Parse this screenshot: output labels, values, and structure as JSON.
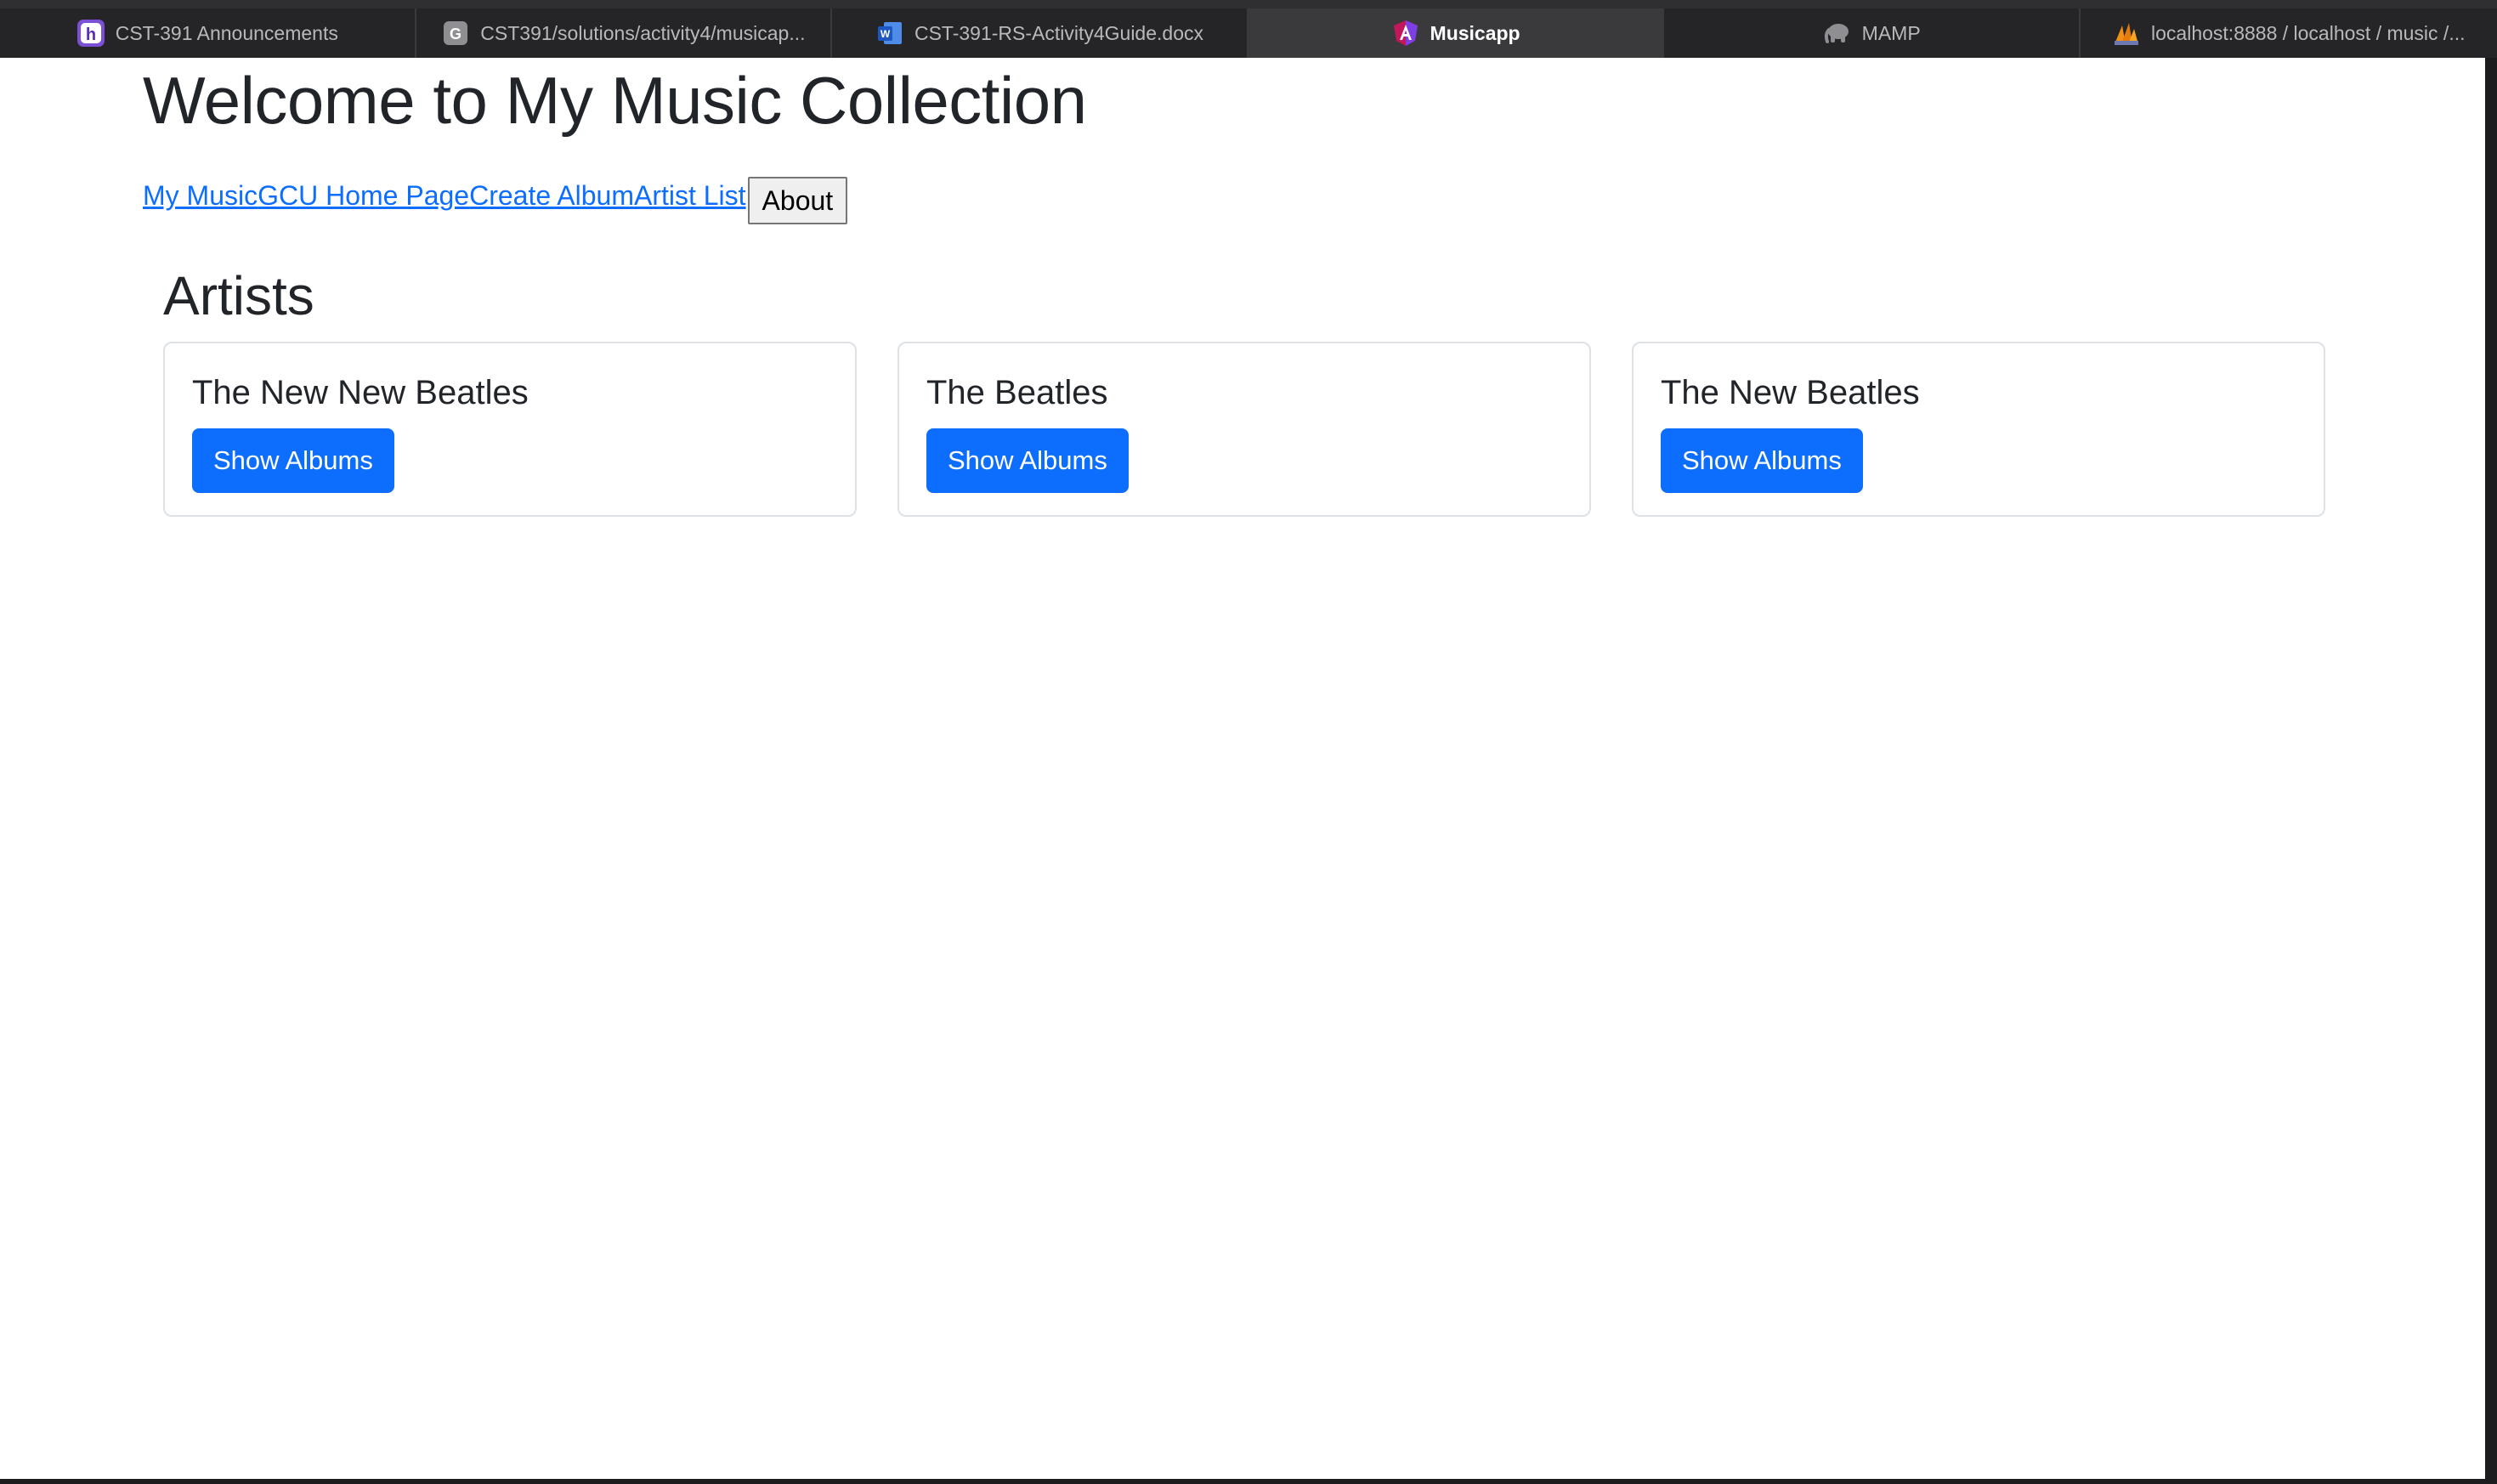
{
  "browser": {
    "tabs": [
      {
        "label": "CST-391 Announcements",
        "icon": "h-app-icon",
        "active": false
      },
      {
        "label": "CST391/solutions/activity4/musicap...",
        "icon": "g-repo-icon",
        "active": false
      },
      {
        "label": "CST-391-RS-Activity4Guide.docx",
        "icon": "word-doc-icon",
        "active": false
      },
      {
        "label": "Musicapp",
        "icon": "angular-icon",
        "active": true
      },
      {
        "label": "MAMP",
        "icon": "elephant-icon",
        "active": false
      },
      {
        "label": "localhost:8888 / localhost / music /...",
        "icon": "phpmyadmin-icon",
        "active": false
      }
    ]
  },
  "page": {
    "title": "Welcome to My Music Collection",
    "nav": {
      "links": [
        "My Music",
        "GCU Home Page",
        "Create Album",
        "Artist List"
      ],
      "about_button": "About"
    },
    "section_title": "Artists",
    "artists": [
      {
        "name": "The New New Beatles",
        "button": "Show Albums"
      },
      {
        "name": "The Beatles",
        "button": "Show Albums"
      },
      {
        "name": "The New Beatles",
        "button": "Show Albums"
      }
    ]
  },
  "colors": {
    "primary": "#0d6efd",
    "link": "#0d6efd",
    "text": "#212529",
    "tab_bar": "#252527",
    "active_tab": "#3a3a3d"
  }
}
